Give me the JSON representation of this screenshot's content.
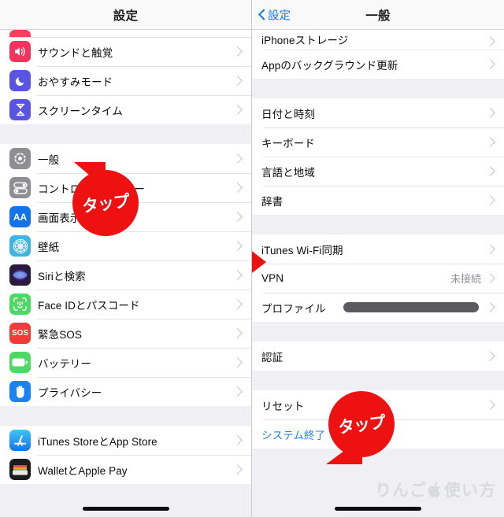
{
  "left_screen": {
    "navbar": {
      "title": "設定"
    },
    "groups": [
      {
        "rows": [
          {
            "label": "",
            "icon": "clipped-red-icon",
            "icon_color": "#f4425c",
            "clipped": true
          },
          {
            "label": "サウンドと触覚",
            "icon": "speaker-icon",
            "icon_color": "#f4335c"
          },
          {
            "label": "おやすみモード",
            "icon": "moon-icon",
            "icon_color": "#5a55e0"
          },
          {
            "label": "スクリーンタイム",
            "icon": "hourglass-icon",
            "icon_color": "#5a55e0"
          }
        ]
      },
      {
        "rows": [
          {
            "label": "一般",
            "icon": "gear-icon",
            "icon_color": "#8e8e93"
          },
          {
            "label": "コントロールセンター",
            "icon": "toggles-icon",
            "icon_color": "#8e8e93"
          },
          {
            "label": "画面表示と明るさ",
            "icon": "text-size-icon",
            "icon_color": "#1473e6"
          },
          {
            "label": "壁紙",
            "icon": "wallpaper-icon",
            "icon_color": "#41b3e0"
          },
          {
            "label": "Siriと検索",
            "icon": "siri-icon",
            "icon_color": "#2b1b3d"
          },
          {
            "label": "Face IDとパスコード",
            "icon": "faceid-icon",
            "icon_color": "#4cd964"
          },
          {
            "label": "緊急SOS",
            "icon": "sos-icon",
            "icon_color": "#f23b36"
          },
          {
            "label": "バッテリー",
            "icon": "battery-icon",
            "icon_color": "#4cd964"
          },
          {
            "label": "プライバシー",
            "icon": "hand-icon",
            "icon_color": "#1a82f2"
          }
        ]
      },
      {
        "rows": [
          {
            "label": "iTunes StoreとApp Store",
            "icon": "appstore-icon",
            "icon_color": "#2b9cf0"
          },
          {
            "label": "WalletとApple Pay",
            "icon": "wallet-icon",
            "icon_color": "#1c1c1e"
          }
        ]
      }
    ],
    "annotation": {
      "bubble_text": "タップ",
      "points_to": "一般"
    }
  },
  "right_screen": {
    "navbar": {
      "back_label": "設定",
      "title": "一般"
    },
    "groups": [
      {
        "rows": [
          {
            "label": "iPhoneストレージ",
            "clipped_top": true
          },
          {
            "label": "Appのバックグラウンド更新"
          }
        ]
      },
      {
        "rows": [
          {
            "label": "日付と時刻"
          },
          {
            "label": "キーボード"
          },
          {
            "label": "言語と地域"
          },
          {
            "label": "辞書"
          }
        ]
      },
      {
        "rows": [
          {
            "label": "iTunes Wi-Fi同期",
            "marked": true
          },
          {
            "label": "VPN",
            "detail": "未接続"
          },
          {
            "label": "プロファイル",
            "redacted": true
          }
        ]
      },
      {
        "rows": [
          {
            "label": "認証"
          }
        ]
      },
      {
        "rows": [
          {
            "label": "リセット"
          },
          {
            "label": "システム終了",
            "link": true
          }
        ]
      }
    ],
    "annotation": {
      "bubble_text": "タップ",
      "points_to": "システム終了"
    },
    "arrow_marker": {
      "points_to": "iTunes Wi-Fi同期",
      "color": "#ee1111"
    }
  },
  "watermark": {
    "text_before": "りんご",
    "apple_glyph": "apple-logo",
    "text_after": "使い方"
  },
  "colors": {
    "accent_blue": "#0a7bf5",
    "annotation_red": "#ee1111",
    "list_background": "#efeff4",
    "row_background": "#ffffff",
    "separator": "#e3e3e6",
    "secondary_text": "#8e8e93"
  }
}
